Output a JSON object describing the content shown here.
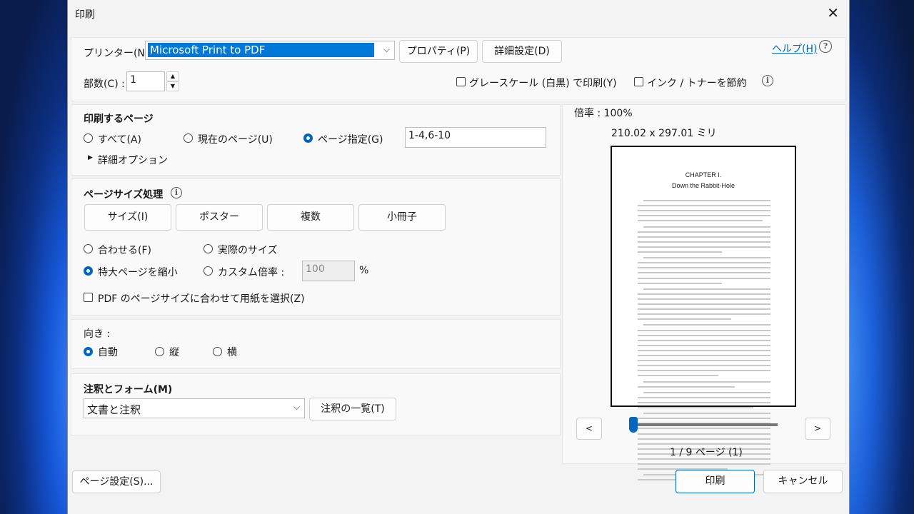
{
  "window": {
    "title": "印刷",
    "close": "✕"
  },
  "printer": {
    "label": "プリンター(N) :",
    "selected": "Microsoft Print to PDF",
    "properties": "プロパティ(P)",
    "advanced": "詳細設定(D)",
    "help": "ヘルプ(H)"
  },
  "copies": {
    "label": "部数(C) :",
    "value": "1"
  },
  "options": {
    "grayscale": "グレースケール (白黒) で印刷(Y)",
    "save_ink": "インク / トナーを節約"
  },
  "pages": {
    "heading": "印刷するページ",
    "all": "すべて(A)",
    "current": "現在のページ(U)",
    "range": "ページ指定(G)",
    "range_value": "1-4,6-10",
    "more": "詳細オプション"
  },
  "sizing": {
    "heading": "ページサイズ処理",
    "buttons": [
      "サイズ(I)",
      "ポスター",
      "複数",
      "小冊子"
    ],
    "fit": "合わせる(F)",
    "actual": "実際のサイズ",
    "shrink": "特大ページを縮小",
    "custom": "カスタム倍率 :",
    "custom_value": "100",
    "percent": "%",
    "pdf_paper": "PDF のページサイズに合わせて用紙を選択(Z)"
  },
  "orientation": {
    "heading": "向き :",
    "auto": "自動",
    "portrait": "縦",
    "landscape": "横"
  },
  "annotations": {
    "heading": "注釈とフォーム(M)",
    "selected": "文書と注釈",
    "summary": "注釈の一覧(T)"
  },
  "preview": {
    "scale": "倍率 : 100%",
    "dimensions": "210.02 x 297.01 ミリ",
    "chapter": "CHAPTER I.",
    "chapter_title": "Down the Rabbit-Hole",
    "prev": "<",
    "next": ">",
    "page_info": "1 / 9 ページ (1)",
    "slider_fraction": 0.0
  },
  "footer": {
    "page_setup": "ページ設定(S)...",
    "print": "印刷",
    "cancel": "キャンセル"
  }
}
